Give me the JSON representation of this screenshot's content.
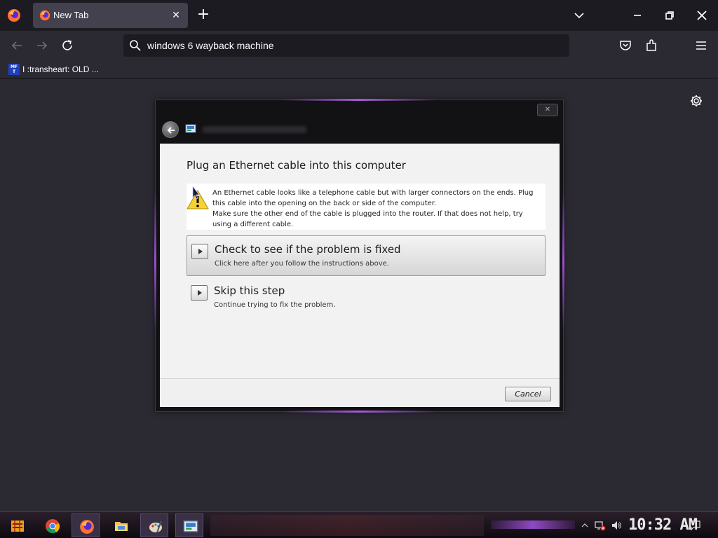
{
  "browser": {
    "tab_title": "New Tab",
    "url_text": "windows 6 wayback machine",
    "bookmark_label": "I :transheart: OLD ...",
    "bookmark_icon_text": "MF T"
  },
  "dialog": {
    "heading": "Plug an Ethernet cable into this computer",
    "info_text": "An Ethernet cable looks like a telephone cable but with larger connectors on the ends. Plug this cable into the opening on the back or side of the computer.\nMake sure the other end of the cable is plugged into the router. If that does not help, try using a different cable.",
    "option1_title": "Check to see if the problem is fixed",
    "option1_subtitle": "Click here after you follow the instructions above.",
    "option2_title": "Skip this step",
    "option2_subtitle": "Continue trying to fix the problem.",
    "cancel_label": "Cancel"
  },
  "taskbar": {
    "clock": "10:32 AM"
  },
  "colors": {
    "accent_purple": "#9b4fd0",
    "browser_bg": "#2b2a33",
    "tabstrip_bg": "#1c1b22"
  },
  "icons": [
    "firefox-icon",
    "close-icon",
    "plus-icon",
    "chevron-down-icon",
    "minimize-icon",
    "restore-icon",
    "back-icon",
    "forward-icon",
    "reload-icon",
    "search-icon",
    "pocket-icon",
    "extensions-icon",
    "menu-icon",
    "gear-icon",
    "warning-icon",
    "play-arrow-icon",
    "start-icon",
    "chrome-icon",
    "file-explorer-icon",
    "paint-icon",
    "troubleshooter-icon",
    "network-icon",
    "volume-icon",
    "notification-icon"
  ]
}
